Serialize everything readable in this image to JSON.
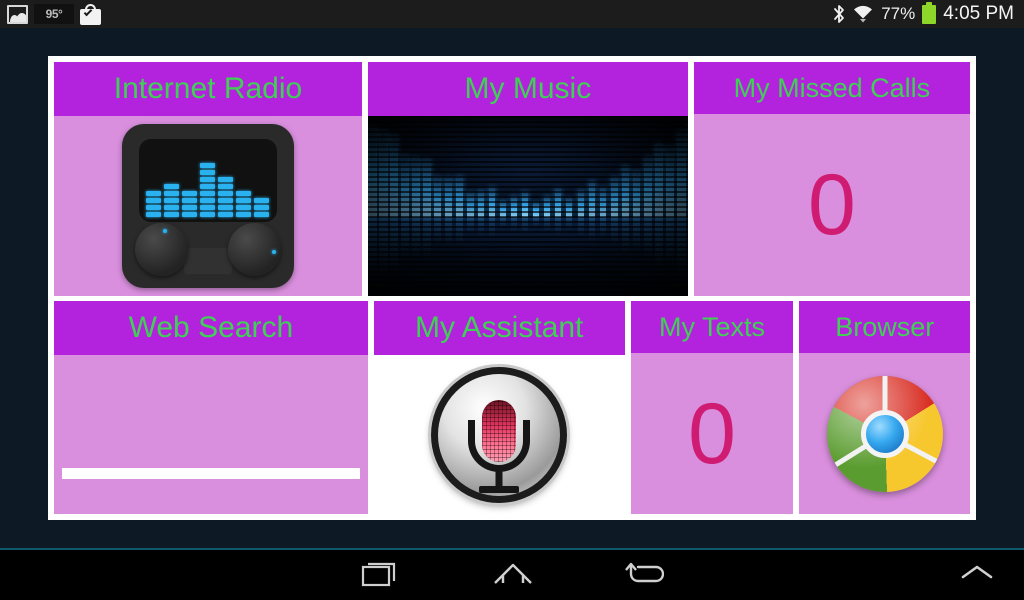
{
  "status_bar": {
    "left_icons": [
      {
        "name": "image-icon",
        "label": ""
      },
      {
        "name": "weather-icon",
        "label": "95°"
      },
      {
        "name": "shopping-bag-check-icon",
        "label": ""
      }
    ],
    "bluetooth_icon": "bluetooth-icon",
    "wifi_icon": "wifi-icon",
    "battery_percent": "77%",
    "battery_icon": "battery-icon",
    "battery_color": "#8ed629",
    "time": "4:05 PM"
  },
  "theme": {
    "header_purple": "#b323de",
    "tile_body_pink": "#d98fdd",
    "header_green": "#3fd154",
    "count_magenta": "#cf1b72",
    "page_background": "#0d1924",
    "panel_background": "#ffffff"
  },
  "tiles": {
    "row1": [
      {
        "id": "internet-radio",
        "title": "Internet Radio",
        "icon": "radio-icon",
        "equalizer_columns": [
          4,
          5,
          4,
          8,
          6,
          4,
          3
        ]
      },
      {
        "id": "my-music",
        "title": "My Music",
        "icon": "music-equalizer-artwork"
      },
      {
        "id": "my-missed-calls",
        "title": "My Missed Calls",
        "count": "0"
      }
    ],
    "row2": [
      {
        "id": "web-search",
        "title": "Web Search",
        "input_value": "",
        "input_placeholder": ""
      },
      {
        "id": "my-assistant",
        "title": "My Assistant",
        "icon": "microphone-icon"
      },
      {
        "id": "my-texts",
        "title": "My Texts",
        "count": "0"
      },
      {
        "id": "browser",
        "title": "Browser",
        "icon": "chrome-icon"
      }
    ]
  },
  "navigation_bar": {
    "recents_label": "recents-icon",
    "home_label": "home-icon",
    "back_label": "back-icon",
    "expand_label": "chevron-up-icon"
  }
}
